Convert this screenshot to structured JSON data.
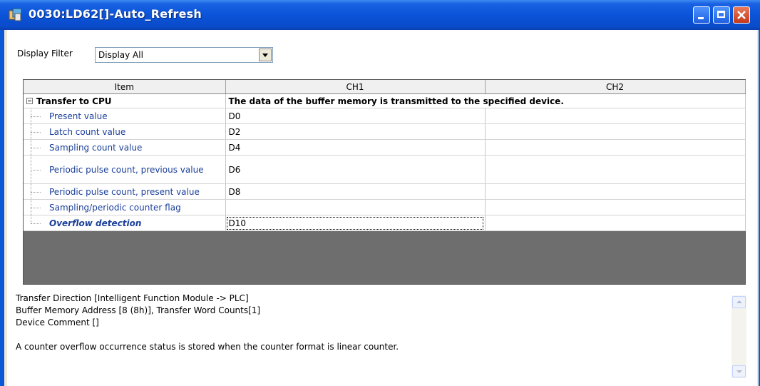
{
  "window": {
    "title": "0030:LD62[]-Auto_Refresh"
  },
  "filter": {
    "label": "Display Filter",
    "selected": "Display All"
  },
  "grid": {
    "headers": [
      "Item",
      "CH1",
      "CH2"
    ],
    "group": {
      "label": "Transfer to CPU",
      "description": "The data of the buffer memory is transmitted to the specified device."
    },
    "rows": [
      {
        "item": "Present value",
        "ch1": "D0",
        "ch2": ""
      },
      {
        "item": "Latch count value",
        "ch1": "D2",
        "ch2": ""
      },
      {
        "item": "Sampling count value",
        "ch1": "D4",
        "ch2": ""
      },
      {
        "item": "Periodic pulse count, previous value",
        "ch1": "D6",
        "ch2": ""
      },
      {
        "item": "Periodic pulse count, present value",
        "ch1": "D8",
        "ch2": ""
      },
      {
        "item": "Sampling/periodic counter flag",
        "ch1": "",
        "ch2": ""
      },
      {
        "item": "Overflow detection",
        "ch1": "D10",
        "ch2": ""
      }
    ]
  },
  "description": {
    "line1": "Transfer Direction [Intelligent Function Module -> PLC]",
    "line2": "Buffer Memory Address [8 (8h)], Transfer Word Counts[1]",
    "line3": "Device Comment []",
    "line4": "A counter overflow occurrence status is stored when the counter format is linear counter."
  }
}
